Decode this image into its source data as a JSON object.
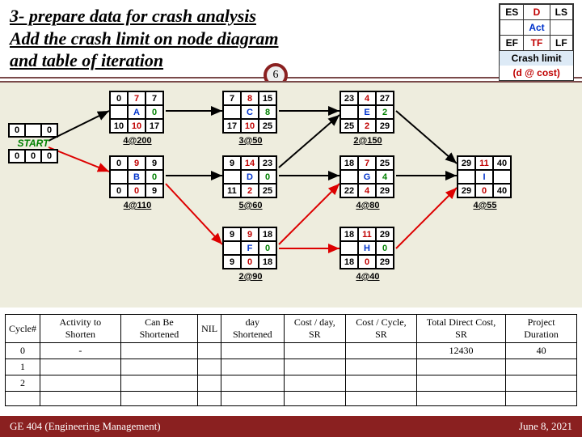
{
  "title_l1": "3- prepare data for crash analysis",
  "title_l2": "Add the crash limit on node diagram",
  "title_l3": "and table of iteration",
  "legend": {
    "r1": [
      "ES",
      "D",
      "LS"
    ],
    "r2": [
      "",
      "Act",
      ""
    ],
    "r3": [
      "EF",
      "TF",
      "LF"
    ],
    "cl": "Crash limit",
    "dc": "(d @ cost)"
  },
  "badge": "6",
  "nodes": {
    "start": {
      "es": "0",
      "d": "",
      "ls": "0",
      "act": "START",
      "ef": "0",
      "tf": "0",
      "lf": "0"
    },
    "A": {
      "es": "0",
      "d": "7",
      "ls": "7",
      "act": "A",
      "sl": "0",
      "ef": "10",
      "tf": "10",
      "lf": "17",
      "cost": "4@200"
    },
    "B": {
      "es": "0",
      "d": "9",
      "ls": "9",
      "act": "B",
      "sl": "0",
      "ef": "0",
      "tf": "0",
      "lf": "9",
      "cost": "4@110"
    },
    "C": {
      "es": "7",
      "d": "8",
      "ls": "15",
      "act": "C",
      "sl": "8",
      "ef": "17",
      "tf": "10",
      "lf": "25",
      "cost": "3@50"
    },
    "D": {
      "es": "9",
      "d": "14",
      "ls": "23",
      "act": "D",
      "sl": "0",
      "ef": "11",
      "tf": "2",
      "lf": "25",
      "cost": "5@60"
    },
    "F": {
      "es": "9",
      "d": "9",
      "ls": "18",
      "act": "F",
      "sl": "0",
      "ef": "9",
      "tf": "0",
      "lf": "18",
      "cost": "2@90"
    },
    "E": {
      "es": "23",
      "d": "4",
      "ls": "27",
      "act": "E",
      "sl": "2",
      "ef": "25",
      "tf": "2",
      "lf": "29",
      "cost": "2@150"
    },
    "G": {
      "es": "18",
      "d": "7",
      "ls": "25",
      "act": "G",
      "sl": "4",
      "ef": "22",
      "tf": "4",
      "lf": "29",
      "cost": "4@80"
    },
    "H": {
      "es": "18",
      "d": "11",
      "ls": "29",
      "act": "H",
      "sl": "0",
      "ef": "18",
      "tf": "0",
      "lf": "29",
      "cost": "4@40"
    },
    "I": {
      "es": "29",
      "d": "11",
      "ls": "40",
      "act": "I",
      "sl": "",
      "ef": "29",
      "tf": "0",
      "lf": "40",
      "cost": "4@55"
    }
  },
  "table": {
    "headers": [
      "Cycle#",
      "Activity to Shorten",
      "Can Be Shortened",
      "NIL",
      "day Shortened",
      "Cost / day, SR",
      "Cost / Cycle, SR",
      "Total Direct Cost, SR",
      "Project Duration"
    ],
    "rows": [
      [
        "0",
        "-",
        "",
        "",
        "",
        "",
        "",
        "12430",
        "40"
      ],
      [
        "1",
        "",
        "",
        "",
        "",
        "",
        "",
        "",
        ""
      ],
      [
        "2",
        "",
        "",
        "",
        "",
        "",
        "",
        "",
        ""
      ]
    ]
  },
  "footer": {
    "left": "GE 404 (Engineering Management)",
    "right": "June 8, 2021"
  }
}
